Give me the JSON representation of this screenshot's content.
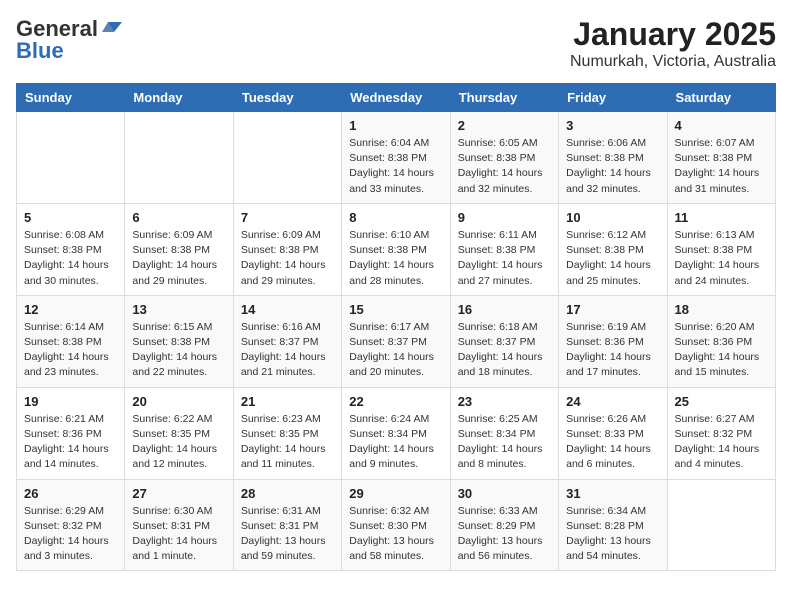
{
  "logo": {
    "general": "General",
    "blue": "Blue"
  },
  "title": "January 2025",
  "subtitle": "Numurkah, Victoria, Australia",
  "days_of_week": [
    "Sunday",
    "Monday",
    "Tuesday",
    "Wednesday",
    "Thursday",
    "Friday",
    "Saturday"
  ],
  "weeks": [
    [
      {
        "day": "",
        "info": ""
      },
      {
        "day": "",
        "info": ""
      },
      {
        "day": "",
        "info": ""
      },
      {
        "day": "1",
        "info": "Sunrise: 6:04 AM\nSunset: 8:38 PM\nDaylight: 14 hours\nand 33 minutes."
      },
      {
        "day": "2",
        "info": "Sunrise: 6:05 AM\nSunset: 8:38 PM\nDaylight: 14 hours\nand 32 minutes."
      },
      {
        "day": "3",
        "info": "Sunrise: 6:06 AM\nSunset: 8:38 PM\nDaylight: 14 hours\nand 32 minutes."
      },
      {
        "day": "4",
        "info": "Sunrise: 6:07 AM\nSunset: 8:38 PM\nDaylight: 14 hours\nand 31 minutes."
      }
    ],
    [
      {
        "day": "5",
        "info": "Sunrise: 6:08 AM\nSunset: 8:38 PM\nDaylight: 14 hours\nand 30 minutes."
      },
      {
        "day": "6",
        "info": "Sunrise: 6:09 AM\nSunset: 8:38 PM\nDaylight: 14 hours\nand 29 minutes."
      },
      {
        "day": "7",
        "info": "Sunrise: 6:09 AM\nSunset: 8:38 PM\nDaylight: 14 hours\nand 29 minutes."
      },
      {
        "day": "8",
        "info": "Sunrise: 6:10 AM\nSunset: 8:38 PM\nDaylight: 14 hours\nand 28 minutes."
      },
      {
        "day": "9",
        "info": "Sunrise: 6:11 AM\nSunset: 8:38 PM\nDaylight: 14 hours\nand 27 minutes."
      },
      {
        "day": "10",
        "info": "Sunrise: 6:12 AM\nSunset: 8:38 PM\nDaylight: 14 hours\nand 25 minutes."
      },
      {
        "day": "11",
        "info": "Sunrise: 6:13 AM\nSunset: 8:38 PM\nDaylight: 14 hours\nand 24 minutes."
      }
    ],
    [
      {
        "day": "12",
        "info": "Sunrise: 6:14 AM\nSunset: 8:38 PM\nDaylight: 14 hours\nand 23 minutes."
      },
      {
        "day": "13",
        "info": "Sunrise: 6:15 AM\nSunset: 8:38 PM\nDaylight: 14 hours\nand 22 minutes."
      },
      {
        "day": "14",
        "info": "Sunrise: 6:16 AM\nSunset: 8:37 PM\nDaylight: 14 hours\nand 21 minutes."
      },
      {
        "day": "15",
        "info": "Sunrise: 6:17 AM\nSunset: 8:37 PM\nDaylight: 14 hours\nand 20 minutes."
      },
      {
        "day": "16",
        "info": "Sunrise: 6:18 AM\nSunset: 8:37 PM\nDaylight: 14 hours\nand 18 minutes."
      },
      {
        "day": "17",
        "info": "Sunrise: 6:19 AM\nSunset: 8:36 PM\nDaylight: 14 hours\nand 17 minutes."
      },
      {
        "day": "18",
        "info": "Sunrise: 6:20 AM\nSunset: 8:36 PM\nDaylight: 14 hours\nand 15 minutes."
      }
    ],
    [
      {
        "day": "19",
        "info": "Sunrise: 6:21 AM\nSunset: 8:36 PM\nDaylight: 14 hours\nand 14 minutes."
      },
      {
        "day": "20",
        "info": "Sunrise: 6:22 AM\nSunset: 8:35 PM\nDaylight: 14 hours\nand 12 minutes."
      },
      {
        "day": "21",
        "info": "Sunrise: 6:23 AM\nSunset: 8:35 PM\nDaylight: 14 hours\nand 11 minutes."
      },
      {
        "day": "22",
        "info": "Sunrise: 6:24 AM\nSunset: 8:34 PM\nDaylight: 14 hours\nand 9 minutes."
      },
      {
        "day": "23",
        "info": "Sunrise: 6:25 AM\nSunset: 8:34 PM\nDaylight: 14 hours\nand 8 minutes."
      },
      {
        "day": "24",
        "info": "Sunrise: 6:26 AM\nSunset: 8:33 PM\nDaylight: 14 hours\nand 6 minutes."
      },
      {
        "day": "25",
        "info": "Sunrise: 6:27 AM\nSunset: 8:32 PM\nDaylight: 14 hours\nand 4 minutes."
      }
    ],
    [
      {
        "day": "26",
        "info": "Sunrise: 6:29 AM\nSunset: 8:32 PM\nDaylight: 14 hours\nand 3 minutes."
      },
      {
        "day": "27",
        "info": "Sunrise: 6:30 AM\nSunset: 8:31 PM\nDaylight: 14 hours\nand 1 minute."
      },
      {
        "day": "28",
        "info": "Sunrise: 6:31 AM\nSunset: 8:31 PM\nDaylight: 13 hours\nand 59 minutes."
      },
      {
        "day": "29",
        "info": "Sunrise: 6:32 AM\nSunset: 8:30 PM\nDaylight: 13 hours\nand 58 minutes."
      },
      {
        "day": "30",
        "info": "Sunrise: 6:33 AM\nSunset: 8:29 PM\nDaylight: 13 hours\nand 56 minutes."
      },
      {
        "day": "31",
        "info": "Sunrise: 6:34 AM\nSunset: 8:28 PM\nDaylight: 13 hours\nand 54 minutes."
      },
      {
        "day": "",
        "info": ""
      }
    ]
  ]
}
